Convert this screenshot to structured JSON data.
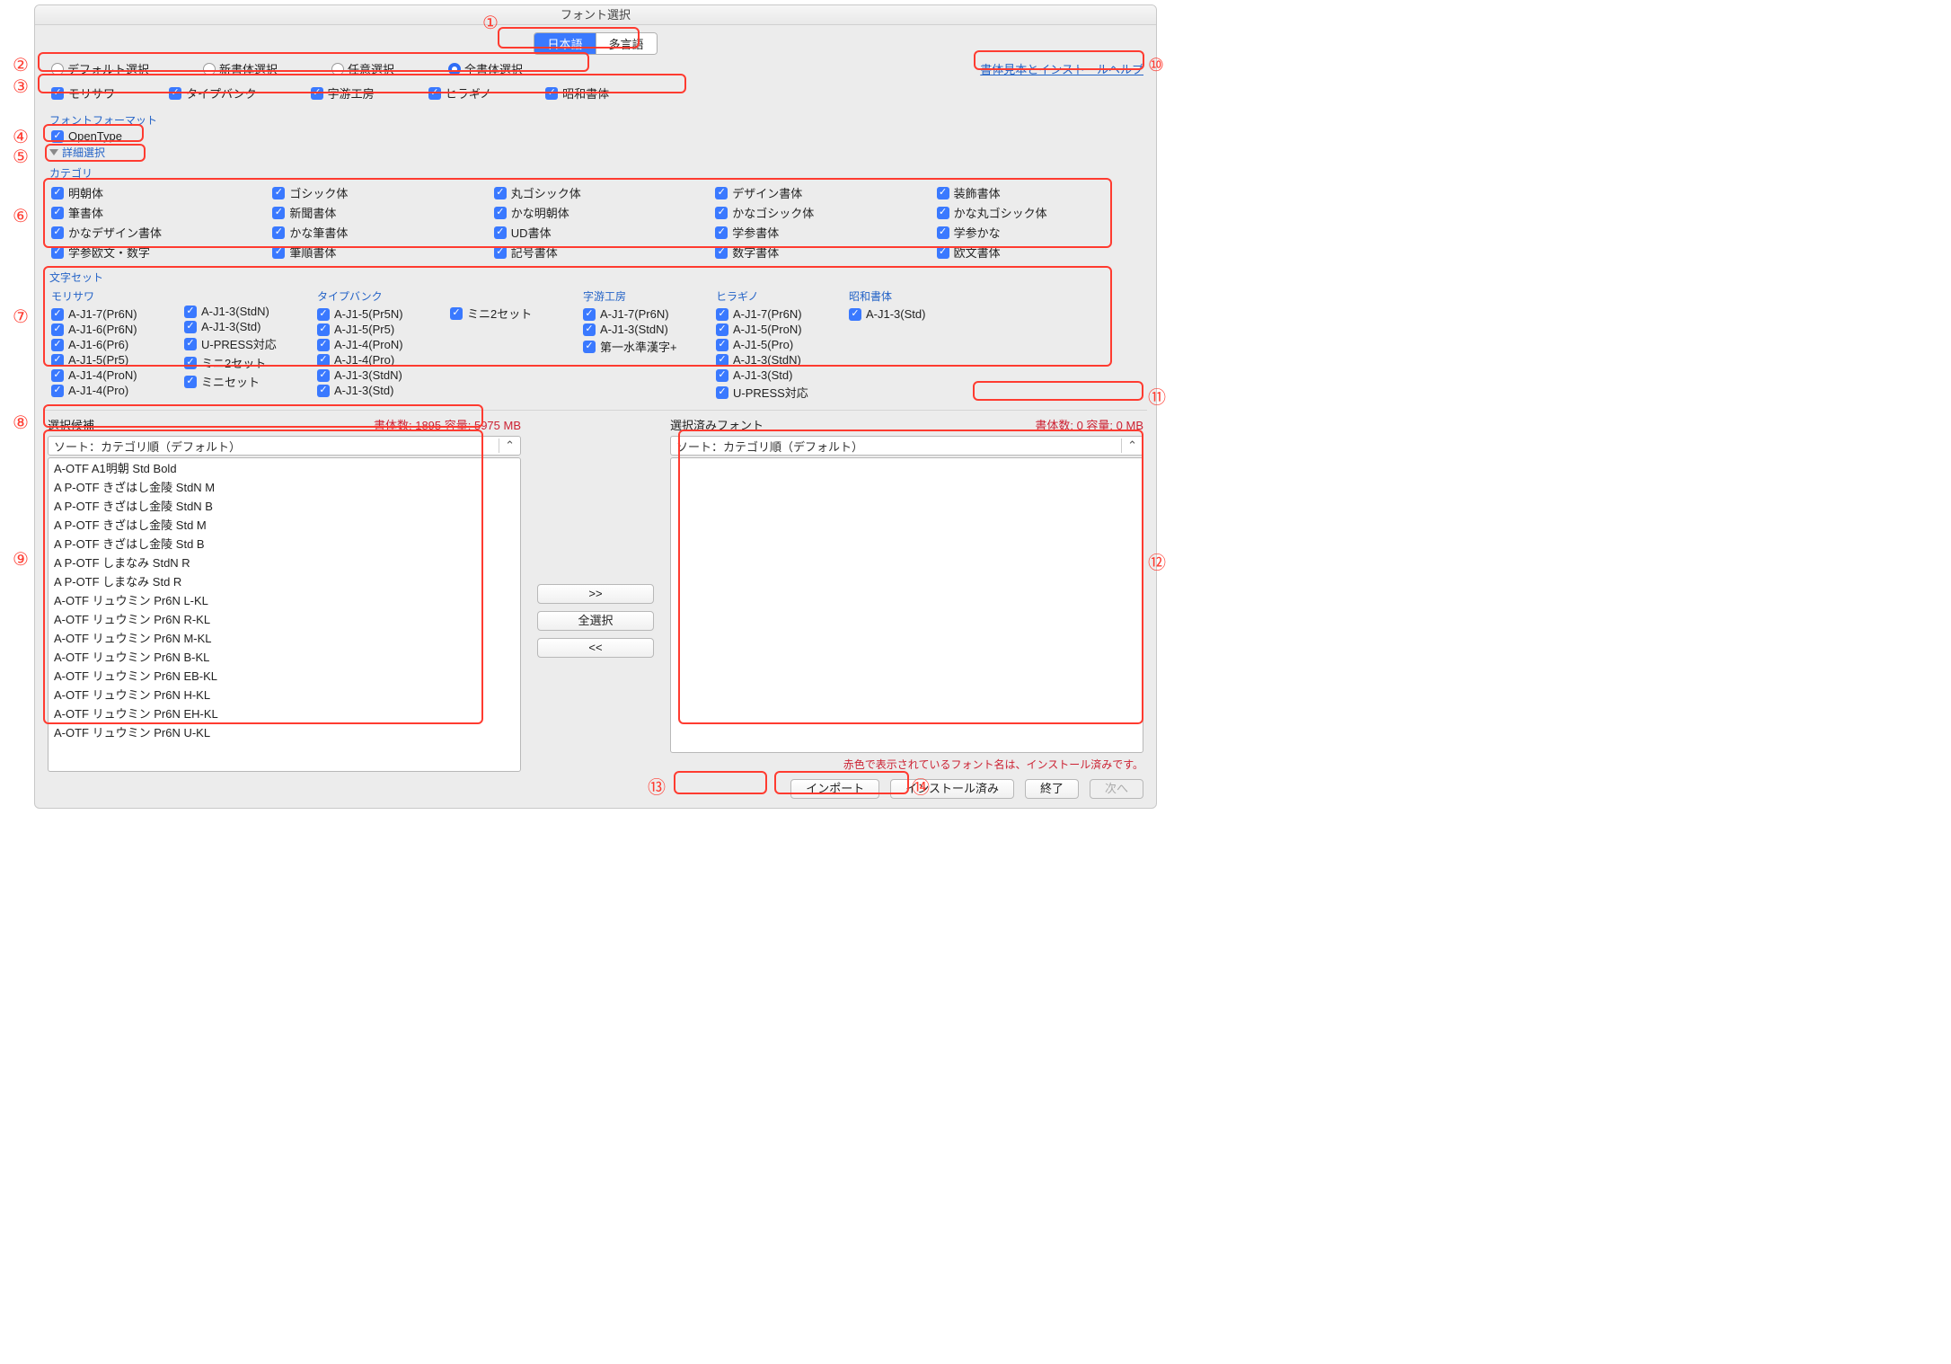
{
  "window": {
    "title": "フォント選択"
  },
  "tabs": {
    "japanese": "日本語",
    "multi": "多言語"
  },
  "selection_mode": {
    "default": "デフォルト選択",
    "new": "新書体選択",
    "any": "任意選択",
    "all": "全書体選択"
  },
  "help_link": "書体見本とインストールヘルプ",
  "vendors": {
    "morisawa": "モリサワ",
    "typebank": "タイプバンク",
    "jiyukobo": "字游工房",
    "hiragino": "ヒラギノ",
    "showa": "昭和書体"
  },
  "font_format": {
    "title": "フォントフォーマット",
    "opentype": "OpenType"
  },
  "advanced": "詳細選択",
  "category": {
    "title": "カテゴリ",
    "items": [
      "明朝体",
      "ゴシック体",
      "丸ゴシック体",
      "デザイン書体",
      "装飾書体",
      "筆書体",
      "新聞書体",
      "かな明朝体",
      "かなゴシック体",
      "かな丸ゴシック体",
      "かなデザイン書体",
      "かな筆書体",
      "UD書体",
      "学参書体",
      "学参かな",
      "学参欧文・数字",
      "筆順書体",
      "記号書体",
      "数字書体",
      "欧文書体"
    ]
  },
  "charset": {
    "title": "文字セット",
    "cols": [
      {
        "head": "モリサワ",
        "items": [
          "A-J1-7(Pr6N)",
          "A-J1-6(Pr6N)",
          "A-J1-6(Pr6)",
          "A-J1-5(Pr5)",
          "A-J1-4(ProN)",
          "A-J1-4(Pro)"
        ]
      },
      {
        "head": "",
        "items": [
          "A-J1-3(StdN)",
          "A-J1-3(Std)",
          "U-PRESS対応",
          "ミニ2セット",
          "ミニセット"
        ]
      },
      {
        "head": "タイプバンク",
        "items": [
          "A-J1-5(Pr5N)",
          "A-J1-5(Pr5)",
          "A-J1-4(ProN)",
          "A-J1-4(Pro)",
          "A-J1-3(StdN)",
          "A-J1-3(Std)"
        ]
      },
      {
        "head": "",
        "items": [
          "ミニ2セット"
        ]
      },
      {
        "head": "字游工房",
        "items": [
          "A-J1-7(Pr6N)",
          "A-J1-3(StdN)",
          "第一水準漢字+"
        ]
      },
      {
        "head": "ヒラギノ",
        "items": [
          "A-J1-7(Pr6N)",
          "A-J1-5(ProN)",
          "A-J1-5(Pro)",
          "A-J1-3(StdN)",
          "A-J1-3(Std)",
          "U-PRESS対応"
        ]
      },
      {
        "head": "昭和書体",
        "items": [
          "A-J1-3(Std)"
        ]
      }
    ]
  },
  "candidates": {
    "title": "選択候補",
    "stats": "書体数: 1895 容量: 5975 MB",
    "sort": "ソート：カテゴリ順（デフォルト）",
    "items": [
      "A-OTF A1明朝 Std Bold",
      "A P-OTF きざはし金陵 StdN M",
      "A P-OTF きざはし金陵 StdN B",
      "A P-OTF きざはし金陵 Std M",
      "A P-OTF きざはし金陵 Std B",
      "A P-OTF しまなみ StdN R",
      "A P-OTF しまなみ Std R",
      "A-OTF リュウミン Pr6N L-KL",
      "A-OTF リュウミン Pr6N R-KL",
      "A-OTF リュウミン Pr6N M-KL",
      "A-OTF リュウミン Pr6N B-KL",
      "A-OTF リュウミン Pr6N EB-KL",
      "A-OTF リュウミン Pr6N H-KL",
      "A-OTF リュウミン Pr6N EH-KL",
      "A-OTF リュウミン Pr6N U-KL"
    ]
  },
  "selected": {
    "title": "選択済みフォント",
    "stats": "書体数: 0 容量: 0 MB",
    "sort": "ソート：カテゴリ順（デフォルト）",
    "items": []
  },
  "midbuttons": {
    "add": ">>",
    "all": "全選択",
    "remove": "<<"
  },
  "footnote": "赤色で表示されているフォント名は、インストール済みです。",
  "footer": {
    "import": "インポート",
    "installed": "インストール済み",
    "quit": "終了",
    "next": "次へ"
  },
  "annotations": {
    "n1": "①",
    "n2": "②",
    "n3": "③",
    "n4": "④",
    "n5": "⑤",
    "n6": "⑥",
    "n7": "⑦",
    "n8": "⑧",
    "n9": "⑨",
    "n10": "⑩",
    "n11": "⑪",
    "n12": "⑫",
    "n13": "⑬",
    "n14": "⑭"
  }
}
